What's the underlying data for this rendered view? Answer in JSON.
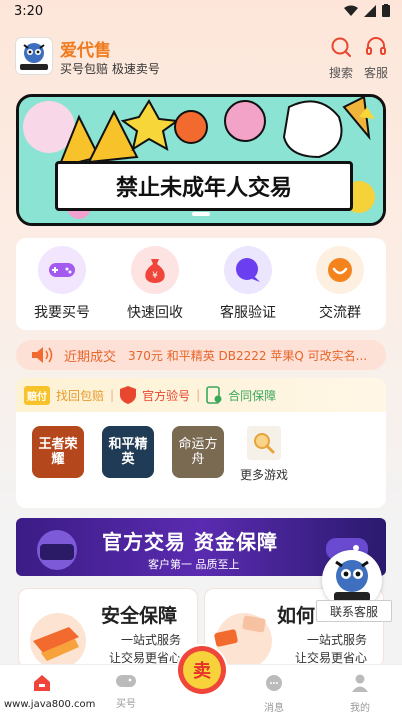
{
  "status": {
    "time": "3:20"
  },
  "header": {
    "brand": "爱代售",
    "slogan": "买号包赔 极速卖号",
    "search_label": "搜索",
    "service_label": "客服"
  },
  "banner": {
    "text": "禁止未成年人交易"
  },
  "quick_actions": [
    {
      "label": "我要买号",
      "icon": "gamepad-icon",
      "color": "#a45af0",
      "bg": "#f1e6fd"
    },
    {
      "label": "快速回收",
      "icon": "money-bag-icon",
      "color": "#f0453a",
      "bg": "#fde3e1"
    },
    {
      "label": "客服验证",
      "icon": "chat-bubble-icon",
      "color": "#6b3ef0",
      "bg": "#ebe6fd"
    },
    {
      "label": "交流群",
      "icon": "smile-chat-icon",
      "color": "#f5831d",
      "bg": "#fdf0e1"
    }
  ],
  "ticker": {
    "label": "近期成交",
    "text": "370元 和平精英 DB2222 苹果Q 可改实名..."
  },
  "guarantee": {
    "badge": "赔付",
    "item1": "找回包赔",
    "item2_badge": "验",
    "item2": "官方验号",
    "item3": "合同保障"
  },
  "games": [
    {
      "label": "王者荣耀",
      "bg": "#b5471c"
    },
    {
      "label": "和平精英",
      "bg": "#1f3b55"
    },
    {
      "label": "命运方舟",
      "bg": "#7a6a52"
    }
  ],
  "more_games": "更多游戏",
  "promo": {
    "headline": "官方交易 资金保障",
    "sub": "客户第一 品质至上"
  },
  "features": [
    {
      "title": "安全保障",
      "line1": "一站式服务",
      "line2": "让交易更省心"
    },
    {
      "title": "如何",
      "line1": "一站式服务",
      "line2": "让交易更省心"
    }
  ],
  "float_service": "联系客服",
  "tabs": [
    {
      "label": "首页",
      "active": true
    },
    {
      "label": "买号"
    },
    {
      "label": "卖号"
    },
    {
      "label": "消息"
    },
    {
      "label": "我的"
    }
  ],
  "watermark": "www.java800.com",
  "colors": {
    "accent": "#f07b1e",
    "ticker": "#e7652a",
    "active_tab": "#f0453a"
  }
}
